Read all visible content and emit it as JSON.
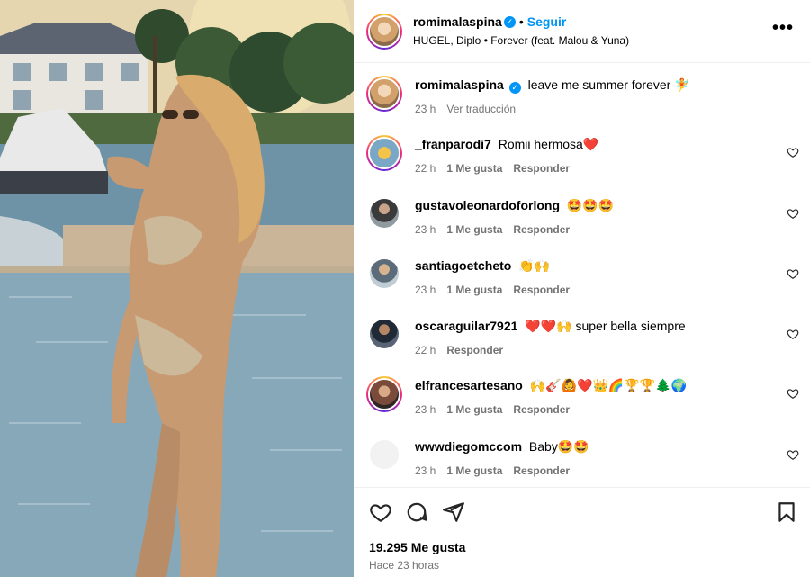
{
  "post": {
    "author": "romimalaspina",
    "verified_mark": "✓",
    "separator": "•",
    "follow_label": "Seguir",
    "audio": "HUGEL, Diplo • Forever (feat. Malou & Yuna)",
    "more_label": "•••"
  },
  "caption": {
    "username": "romimalaspina",
    "text": "leave me summer forever 🧚",
    "time": "23 h",
    "translate": "Ver traducción"
  },
  "comments": [
    {
      "username": "_franparodi7",
      "text": "Romii hermosa❤️",
      "time": "22 h",
      "likes": "1 Me gusta",
      "reply": "Responder"
    },
    {
      "username": "gustavoleonardoforlong",
      "text": "🤩🤩🤩",
      "time": "23 h",
      "likes": "1 Me gusta",
      "reply": "Responder"
    },
    {
      "username": "santiagoetcheto",
      "text": "👏🙌",
      "time": "23 h",
      "likes": "1 Me gusta",
      "reply": "Responder"
    },
    {
      "username": "oscaraguilar7921",
      "text": "❤️❤️🙌 super bella siempre",
      "time": "22 h",
      "likes": "",
      "reply": "Responder"
    },
    {
      "username": "elfrancesartesano",
      "text": "🙌🎸🙆❤️👑🌈🏆🏆🌲🌍",
      "time": "23 h",
      "likes": "1 Me gusta",
      "reply": "Responder"
    },
    {
      "username": "wwwdiegomccom",
      "text": "Baby🤩🤩",
      "time": "23 h",
      "likes": "1 Me gusta",
      "reply": "Responder"
    }
  ],
  "footer": {
    "likes": "19.295 Me gusta",
    "time": "Hace 23 horas"
  },
  "icons": {
    "like": "heart-icon",
    "comment": "comment-icon",
    "share": "paper-plane-icon",
    "save": "bookmark-icon"
  },
  "colors": {
    "accent": "#0095f6",
    "muted": "#737373",
    "border": "#efefef"
  }
}
